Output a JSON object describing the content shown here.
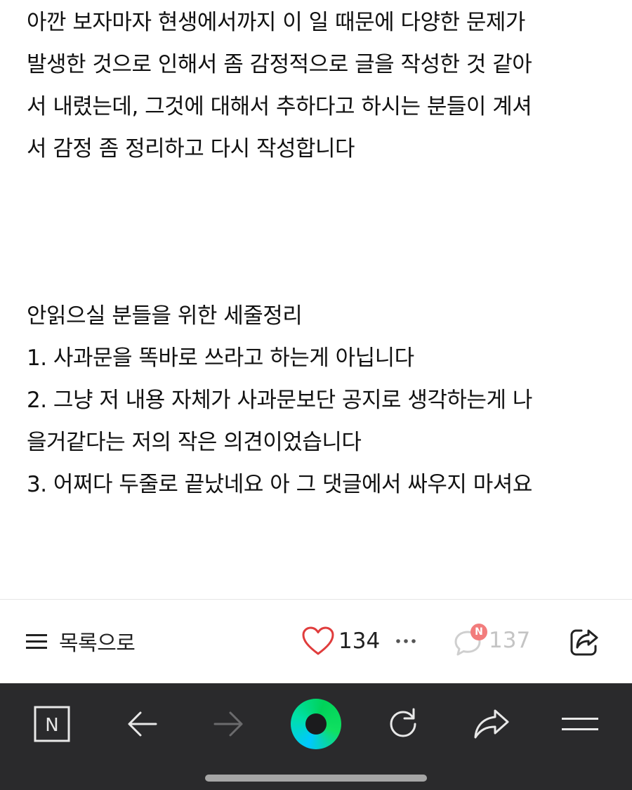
{
  "article": {
    "paragraph_1": [
      "아깐 보자마자 현생에서까지 이 일 때문에 다양한 문제가",
      "발생한 것으로 인해서 좀 감정적으로 글을 작성한 것 같아",
      "서 내렸는데, 그것에 대해서 추하다고 하시는 분들이 계셔",
      "서 감정 좀 정리하고 다시 작성합니다"
    ],
    "paragraph_2": [
      "안읽으실 분들을 위한 세줄정리",
      "1. 사과문을 똑바로 쓰라고 하는게 아닙니다",
      "2. 그냥 저 내용 자체가 사과문보단 공지로 생각하는게 나",
      "을거같다는 저의 작은 의견이었습니다",
      "3. 어쩌다 두줄로 끝났네요 아 그 댓글에서 싸우지 마셔요"
    ]
  },
  "action_bar": {
    "list_label": "목록으로",
    "like_count": "134",
    "comment_count": "137",
    "comment_badge": "N",
    "like_color": "#e03c3c",
    "comment_color": "#c4c4c4"
  },
  "browser_bar": {
    "naver_letter": "N",
    "icons": [
      "naver-icon",
      "back-arrow-icon",
      "forward-arrow-icon",
      "green-dot-home-icon",
      "refresh-icon",
      "share-icon",
      "menu-icon"
    ],
    "background": "#2a2a2c"
  }
}
